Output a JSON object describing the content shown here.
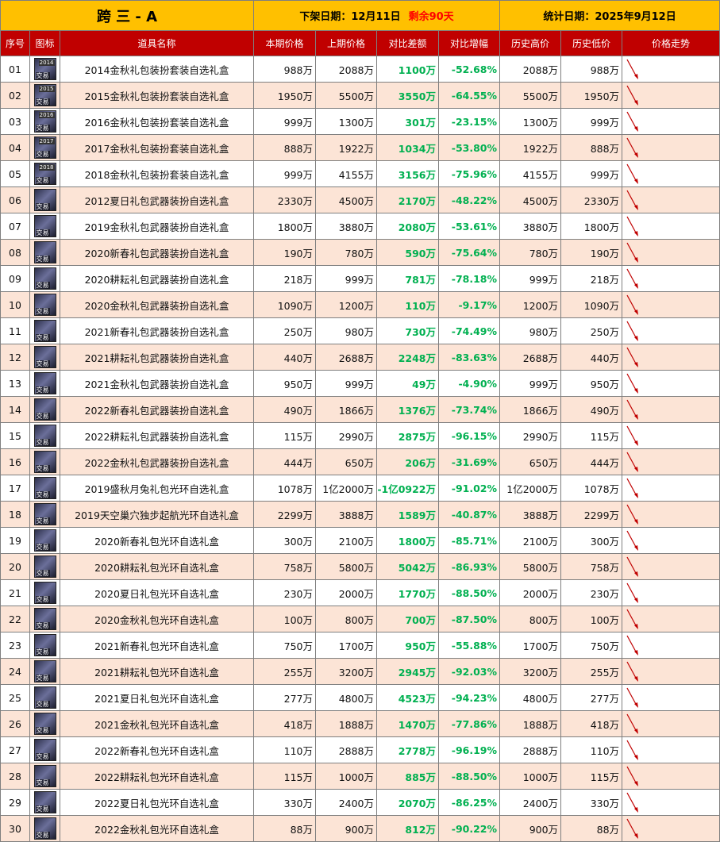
{
  "header": {
    "title": "跨 三 - A",
    "delist_label": "下架日期：",
    "delist_date": "12月11日",
    "remaining": "剩余90天",
    "stat_label": "统计日期：",
    "stat_date": "2025年9月12日"
  },
  "columns": [
    "序号",
    "图标",
    "道具名称",
    "本期价格",
    "上期价格",
    "对比差额",
    "对比增幅",
    "历史高价",
    "历史低价",
    "价格走势"
  ],
  "icon_badge": "交易",
  "colors": {
    "header_bg": "#ffc000",
    "column_header_bg": "#c00000",
    "stripe": "#fce4d6",
    "positive": "#00b050",
    "remaining": "#ff0000",
    "trend_line": "#c00000"
  },
  "rows": [
    {
      "idx": "01",
      "icon": "box-icon",
      "year": "2014",
      "name": "2014金秋礼包装扮套装自选礼盒",
      "cur": "988万",
      "prev": "2088万",
      "diff": "1100万",
      "pct": "-52.68%",
      "high": "2088万",
      "low": "988万"
    },
    {
      "idx": "02",
      "icon": "box-icon",
      "year": "2015",
      "name": "2015金秋礼包装扮套装自选礼盒",
      "cur": "1950万",
      "prev": "5500万",
      "diff": "3550万",
      "pct": "-64.55%",
      "high": "5500万",
      "low": "1950万"
    },
    {
      "idx": "03",
      "icon": "box-icon",
      "year": "2016",
      "name": "2016金秋礼包装扮套装自选礼盒",
      "cur": "999万",
      "prev": "1300万",
      "diff": "301万",
      "pct": "-23.15%",
      "high": "1300万",
      "low": "999万"
    },
    {
      "idx": "04",
      "icon": "box-icon",
      "year": "2017",
      "name": "2017金秋礼包装扮套装自选礼盒",
      "cur": "888万",
      "prev": "1922万",
      "diff": "1034万",
      "pct": "-53.80%",
      "high": "1922万",
      "low": "888万"
    },
    {
      "idx": "05",
      "icon": "box-icon",
      "year": "2018",
      "name": "2018金秋礼包装扮套装自选礼盒",
      "cur": "999万",
      "prev": "4155万",
      "diff": "3156万",
      "pct": "-75.96%",
      "high": "4155万",
      "low": "999万"
    },
    {
      "idx": "06",
      "icon": "weapon-icon",
      "year": "",
      "name": "2012夏日礼包武器装扮自选礼盒",
      "cur": "2330万",
      "prev": "4500万",
      "diff": "2170万",
      "pct": "-48.22%",
      "high": "4500万",
      "low": "2330万"
    },
    {
      "idx": "07",
      "icon": "weapon-icon",
      "year": "",
      "name": "2019金秋礼包武器装扮自选礼盒",
      "cur": "1800万",
      "prev": "3880万",
      "diff": "2080万",
      "pct": "-53.61%",
      "high": "3880万",
      "low": "1800万"
    },
    {
      "idx": "08",
      "icon": "weapon-icon",
      "year": "",
      "name": "2020新春礼包武器装扮自选礼盒",
      "cur": "190万",
      "prev": "780万",
      "diff": "590万",
      "pct": "-75.64%",
      "high": "780万",
      "low": "190万"
    },
    {
      "idx": "09",
      "icon": "weapon-icon",
      "year": "",
      "name": "2020耕耘礼包武器装扮自选礼盒",
      "cur": "218万",
      "prev": "999万",
      "diff": "781万",
      "pct": "-78.18%",
      "high": "999万",
      "low": "218万"
    },
    {
      "idx": "10",
      "icon": "weapon-icon",
      "year": "",
      "name": "2020金秋礼包武器装扮自选礼盒",
      "cur": "1090万",
      "prev": "1200万",
      "diff": "110万",
      "pct": "-9.17%",
      "high": "1200万",
      "low": "1090万"
    },
    {
      "idx": "11",
      "icon": "weapon-icon",
      "year": "",
      "name": "2021新春礼包武器装扮自选礼盒",
      "cur": "250万",
      "prev": "980万",
      "diff": "730万",
      "pct": "-74.49%",
      "high": "980万",
      "low": "250万"
    },
    {
      "idx": "12",
      "icon": "weapon-icon",
      "year": "",
      "name": "2021耕耘礼包武器装扮自选礼盒",
      "cur": "440万",
      "prev": "2688万",
      "diff": "2248万",
      "pct": "-83.63%",
      "high": "2688万",
      "low": "440万"
    },
    {
      "idx": "13",
      "icon": "weapon-icon",
      "year": "",
      "name": "2021金秋礼包武器装扮自选礼盒",
      "cur": "950万",
      "prev": "999万",
      "diff": "49万",
      "pct": "-4.90%",
      "high": "999万",
      "low": "950万"
    },
    {
      "idx": "14",
      "icon": "weapon-icon",
      "year": "",
      "name": "2022新春礼包武器装扮自选礼盒",
      "cur": "490万",
      "prev": "1866万",
      "diff": "1376万",
      "pct": "-73.74%",
      "high": "1866万",
      "low": "490万"
    },
    {
      "idx": "15",
      "icon": "weapon-icon",
      "year": "",
      "name": "2022耕耘礼包武器装扮自选礼盒",
      "cur": "115万",
      "prev": "2990万",
      "diff": "2875万",
      "pct": "-96.15%",
      "high": "2990万",
      "low": "115万"
    },
    {
      "idx": "16",
      "icon": "weapon-icon",
      "year": "",
      "name": "2022金秋礼包武器装扮自选礼盒",
      "cur": "444万",
      "prev": "650万",
      "diff": "206万",
      "pct": "-31.69%",
      "high": "650万",
      "low": "444万"
    },
    {
      "idx": "17",
      "icon": "aura-icon",
      "year": "",
      "name": "2019盛秋月兔礼包光环自选礼盒",
      "cur": "1078万",
      "prev": "1亿2000万",
      "diff": "-1亿0922万",
      "pct": "-91.02%",
      "high": "1亿2000万",
      "low": "1078万"
    },
    {
      "idx": "18",
      "icon": "aura-icon",
      "year": "",
      "name": "2019天空巢穴独步起航光环自选礼盒",
      "cur": "2299万",
      "prev": "3888万",
      "diff": "1589万",
      "pct": "-40.87%",
      "high": "3888万",
      "low": "2299万"
    },
    {
      "idx": "19",
      "icon": "aura-icon",
      "year": "",
      "name": "2020新春礼包光环自选礼盒",
      "cur": "300万",
      "prev": "2100万",
      "diff": "1800万",
      "pct": "-85.71%",
      "high": "2100万",
      "low": "300万"
    },
    {
      "idx": "20",
      "icon": "aura-icon",
      "year": "",
      "name": "2020耕耘礼包光环自选礼盒",
      "cur": "758万",
      "prev": "5800万",
      "diff": "5042万",
      "pct": "-86.93%",
      "high": "5800万",
      "low": "758万"
    },
    {
      "idx": "21",
      "icon": "aura-icon",
      "year": "",
      "name": "2020夏日礼包光环自选礼盒",
      "cur": "230万",
      "prev": "2000万",
      "diff": "1770万",
      "pct": "-88.50%",
      "high": "2000万",
      "low": "230万"
    },
    {
      "idx": "22",
      "icon": "aura-icon",
      "year": "",
      "name": "2020金秋礼包光环自选礼盒",
      "cur": "100万",
      "prev": "800万",
      "diff": "700万",
      "pct": "-87.50%",
      "high": "800万",
      "low": "100万"
    },
    {
      "idx": "23",
      "icon": "aura-icon",
      "year": "",
      "name": "2021新春礼包光环自选礼盒",
      "cur": "750万",
      "prev": "1700万",
      "diff": "950万",
      "pct": "-55.88%",
      "high": "1700万",
      "low": "750万"
    },
    {
      "idx": "24",
      "icon": "aura-icon",
      "year": "",
      "name": "2021耕耘礼包光环自选礼盒",
      "cur": "255万",
      "prev": "3200万",
      "diff": "2945万",
      "pct": "-92.03%",
      "high": "3200万",
      "low": "255万"
    },
    {
      "idx": "25",
      "icon": "aura-icon",
      "year": "",
      "name": "2021夏日礼包光环自选礼盒",
      "cur": "277万",
      "prev": "4800万",
      "diff": "4523万",
      "pct": "-94.23%",
      "high": "4800万",
      "low": "277万"
    },
    {
      "idx": "26",
      "icon": "aura-icon",
      "year": "",
      "name": "2021金秋礼包光环自选礼盒",
      "cur": "418万",
      "prev": "1888万",
      "diff": "1470万",
      "pct": "-77.86%",
      "high": "1888万",
      "low": "418万"
    },
    {
      "idx": "27",
      "icon": "aura-icon",
      "year": "",
      "name": "2022新春礼包光环自选礼盒",
      "cur": "110万",
      "prev": "2888万",
      "diff": "2778万",
      "pct": "-96.19%",
      "high": "2888万",
      "low": "110万"
    },
    {
      "idx": "28",
      "icon": "aura-icon",
      "year": "",
      "name": "2022耕耘礼包光环自选礼盒",
      "cur": "115万",
      "prev": "1000万",
      "diff": "885万",
      "pct": "-88.50%",
      "high": "1000万",
      "low": "115万"
    },
    {
      "idx": "29",
      "icon": "aura-icon",
      "year": "",
      "name": "2022夏日礼包光环自选礼盒",
      "cur": "330万",
      "prev": "2400万",
      "diff": "2070万",
      "pct": "-86.25%",
      "high": "2400万",
      "low": "330万"
    },
    {
      "idx": "30",
      "icon": "aura-icon",
      "year": "",
      "name": "2022金秋礼包光环自选礼盒",
      "cur": "88万",
      "prev": "900万",
      "diff": "812万",
      "pct": "-90.22%",
      "high": "900万",
      "low": "88万"
    }
  ]
}
